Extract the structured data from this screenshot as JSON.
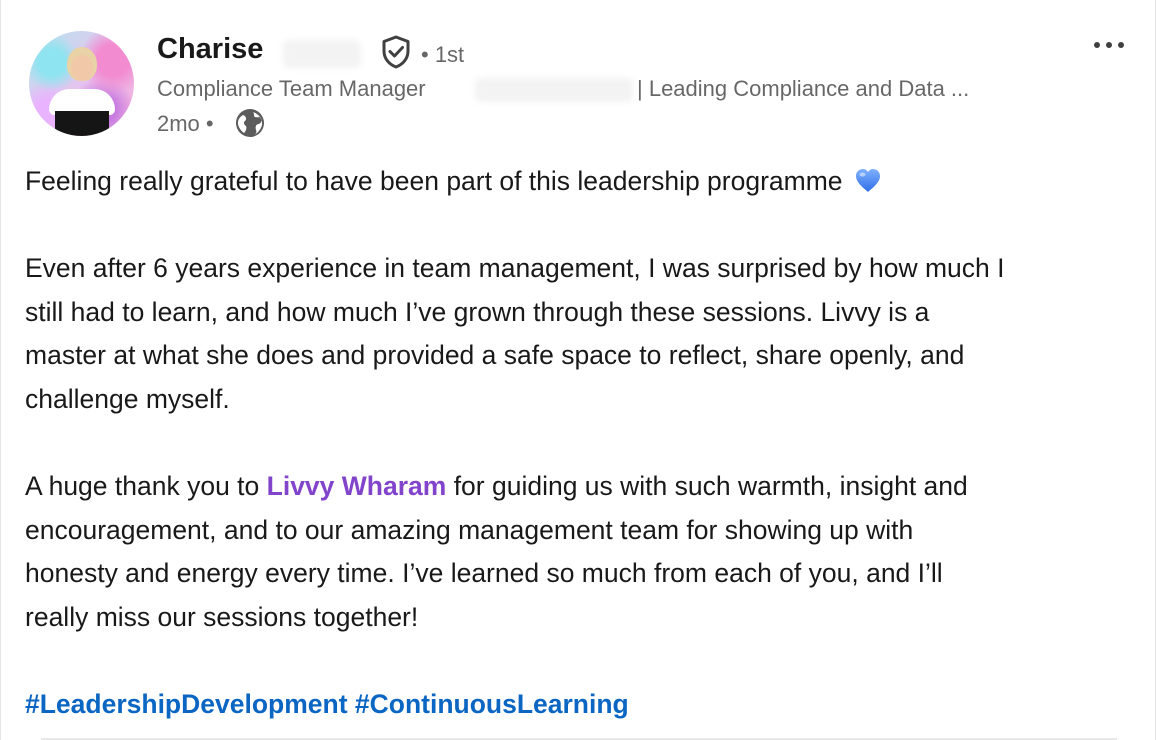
{
  "author": {
    "name": "Charise",
    "degree": "• 1st",
    "headline_prefix": "Compliance Team Manager",
    "headline_suffix": "| Leading Compliance and Data ...",
    "timestamp": "2mo •",
    "visibility_icon": "globe-icon",
    "verified_icon": "verified-shield-icon"
  },
  "menu_icon": "more-options-icon",
  "post": {
    "line1": "Feeling really grateful to have been part of this leadership programme",
    "line1_emoji": "blue-heart-icon",
    "para2": [
      "Even after 6 years experience in team management, I was surprised by how much I",
      "still had to learn, and how much I’ve grown through these sessions. Livvy is a",
      "master at what she does and provided a safe space to reflect, share openly, and",
      "challenge myself."
    ],
    "para3_start": "A huge thank you to ",
    "mention": "Livvy Wharam",
    "para3_rest": " for guiding us with such warmth, insight and",
    "para3_lines": [
      "encouragement, and to our amazing management team for showing up with",
      "honesty and energy every time. I’ve learned so much from each of you, and I’ll",
      "really miss our sessions together!"
    ],
    "hashtags": [
      "#LeadershipDevelopment",
      "#ContinuousLearning"
    ]
  },
  "colors": {
    "mention": "#8344cc",
    "hashtag": "#0a66c2",
    "text": "#1a1a1a",
    "secondary": "#666666"
  }
}
